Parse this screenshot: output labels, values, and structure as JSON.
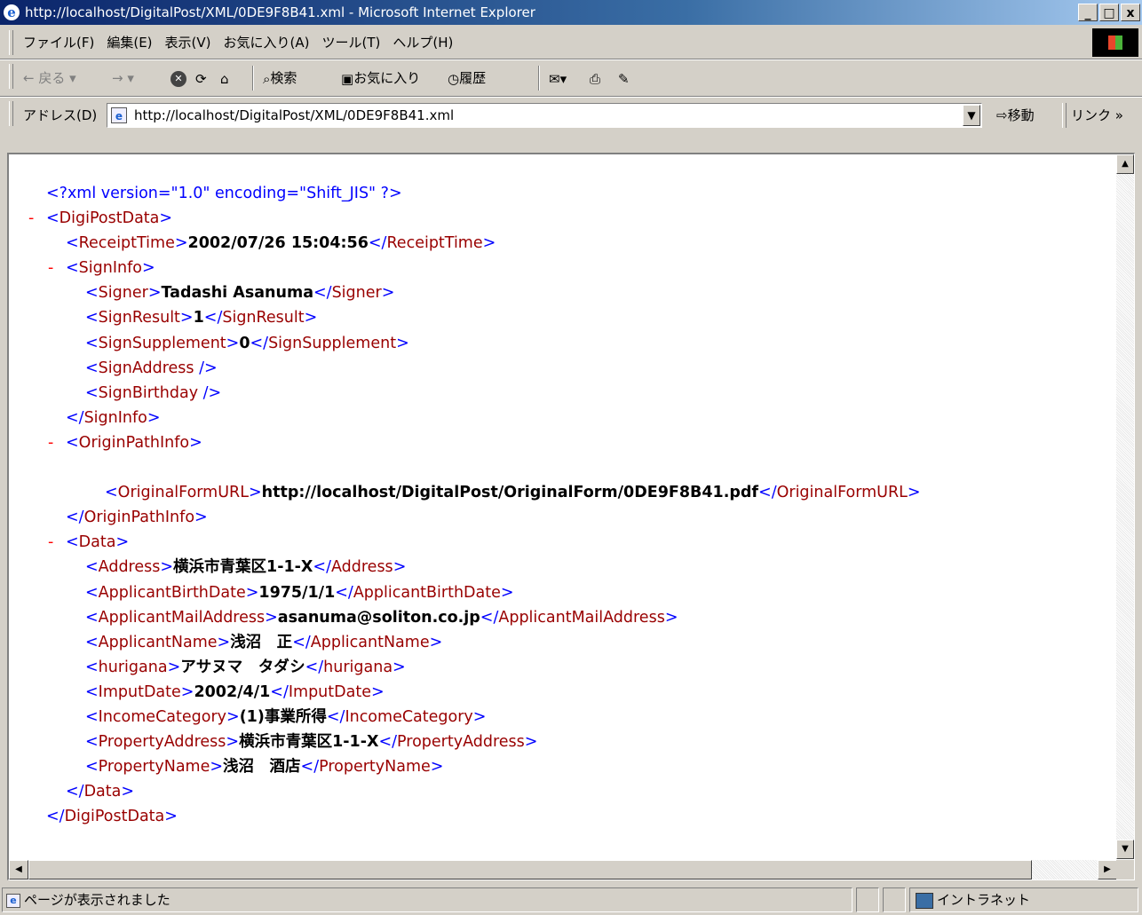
{
  "window": {
    "title": "http://localhost/DigitalPost/XML/0DE9F8B41.xml - Microsoft Internet Explorer",
    "buttons": [
      "_",
      "□",
      "x"
    ]
  },
  "menu": [
    "ファイル(F)",
    "編集(E)",
    "表示(V)",
    "お気に入り(A)",
    "ツール(T)",
    "ヘルプ(H)"
  ],
  "toolbar": {
    "back": "← 戻る",
    "forward": "→",
    "search": "検索",
    "favorites": "お気に入り",
    "history": "履歴"
  },
  "address": {
    "label": "アドレス(D)",
    "url": "http://localhost/DigitalPost/XML/0DE9F8B41.xml",
    "go": "移動",
    "links": "リンク »"
  },
  "xml": {
    "decl": "<?xml version=\"1.0\" encoding=\"Shift_JIS\" ?>",
    "minus": "-",
    "root": "DigiPostData",
    "receipt_tag": "ReceiptTime",
    "receipt_value": "2002/07/26 15:04:56",
    "signinfo_tag": "SignInfo",
    "signer_tag": "Signer",
    "signer_value": "Tadashi Asanuma",
    "signresult_tag": "SignResult",
    "signresult_value": "1",
    "signsupp_tag": "SignSupplement",
    "signsupp_value": "0",
    "signaddress_tag": "SignAddress",
    "signbirthday_tag": "SignBirthday",
    "originpath_tag": "OriginPathInfo",
    "originalform_tag": "OriginalFormURL",
    "originalform_value": "http://localhost/DigitalPost/OriginalForm/0DE9F8B41.pdf",
    "data_tag": "Data",
    "address_tag": "Address",
    "address_value": "横浜市青葉区1-1-X",
    "birth_tag": "ApplicantBirthDate",
    "birth_value": "1975/1/1",
    "mail_tag": "ApplicantMailAddress",
    "mail_value": "asanuma@soliton.co.jp",
    "name_tag": "ApplicantName",
    "name_value": "浅沼　正",
    "hurigana_tag": "hurigana",
    "hurigana_value": "アサヌマ　タダシ",
    "imput_tag": "ImputDate",
    "imput_value": "2002/4/1",
    "income_tag": "IncomeCategory",
    "income_value": "(1)事業所得",
    "propaddr_tag": "PropertyAddress",
    "propaddr_value": "横浜市青葉区1-1-X",
    "propname_tag": "PropertyName",
    "propname_value": "浅沼　酒店"
  },
  "status": {
    "message": "ページが表示されました",
    "zone": "イントラネット"
  },
  "colors": {
    "tag": "#990000",
    "bracket": "#0000ff",
    "minus": "#ff0000"
  }
}
